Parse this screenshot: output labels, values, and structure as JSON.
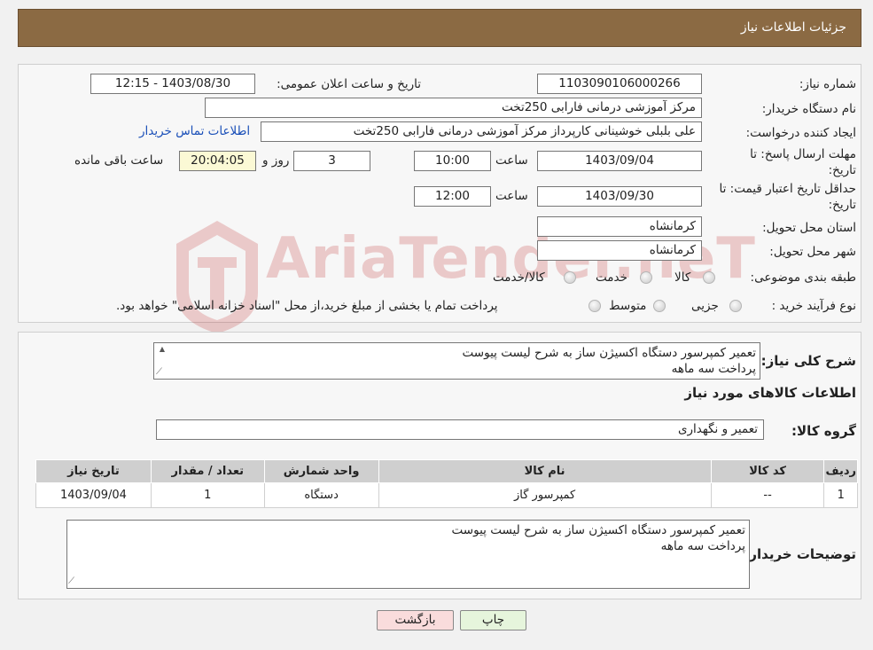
{
  "header": {
    "title": "جزئیات اطلاعات نیاز"
  },
  "form": {
    "need_number_label": "شماره نیاز:",
    "need_number": "1103090106000266",
    "announce_label": "تاریخ و ساعت اعلان عمومی:",
    "announce_value": "1403/08/30 - 12:15",
    "buyer_org_label": "نام دستگاه خریدار:",
    "buyer_org": "مرکز آموزشی  درمانی فارابی 250تخت",
    "requester_label": "ایجاد کننده درخواست:",
    "requester": "علی بلبلی خوشینانی کارپرداز مرکز آموزشی  درمانی فارابی 250تخت",
    "contact_link": "اطلاعات تماس خریدار",
    "deadline_label": "مهلت ارسال پاسخ: تا",
    "deadline_label2": "تاریخ:",
    "deadline_date": "1403/09/04",
    "time_word": "ساعت",
    "deadline_time": "10:00",
    "days_value": "3",
    "days_word": "روز و",
    "remaining_time": "20:04:05",
    "remaining_word": "ساعت باقی مانده",
    "validity_label": "حداقل تاریخ اعتبار قیمت: تا",
    "validity_label2": "تاریخ:",
    "validity_date": "1403/09/30",
    "validity_time": "12:00",
    "province_label": "استان محل تحویل:",
    "province": "کرمانشاه",
    "city_label": "شهر محل تحویل:",
    "city": "کرمانشاه",
    "category_label": "طبقه بندی موضوعی:",
    "category_options": [
      "کالا",
      "خدمت",
      "کالا/خدمت"
    ],
    "purchase_type_label": "نوع فرآیند خرید :",
    "purchase_options": [
      "جزیی",
      "متوسط"
    ],
    "purchase_note": "پرداخت تمام یا بخشی از مبلغ خرید،از محل \"اسناد خزانه اسلامی\" خواهد بود."
  },
  "summary": {
    "label": "شرح کلی نیاز:",
    "text": "تعمیر کمپرسور  دستگاه اکسیژن ساز به شرح لیست پیوست\nپرداخت سه ماهه"
  },
  "goods": {
    "section_title": "اطلاعات کالاهای مورد نیاز",
    "group_label": "گروه کالا:",
    "group_value": "تعمیر و نگهداری",
    "columns": [
      "ردیف",
      "کد کالا",
      "نام کالا",
      "واحد شمارش",
      "تعداد / مقدار",
      "تاریخ نیاز"
    ],
    "rows": [
      [
        "1",
        "--",
        "کمپرسور گاز",
        "دستگاه",
        "1",
        "1403/09/04"
      ]
    ],
    "buyer_notes_label": "توضیحات خریدار:",
    "buyer_notes": "تعمیر کمپرسور  دستگاه اکسیژن ساز به شرح لیست پیوست\nپرداخت سه ماهه"
  },
  "buttons": {
    "print": "چاپ",
    "back": "بازگشت"
  },
  "watermark": {
    "text": "AriaTender.neT"
  },
  "colors": {
    "header": "#8b6a43",
    "print_btn": "#e6f5dc",
    "back_btn": "#f9dcdc",
    "link": "#1a4fb8"
  }
}
